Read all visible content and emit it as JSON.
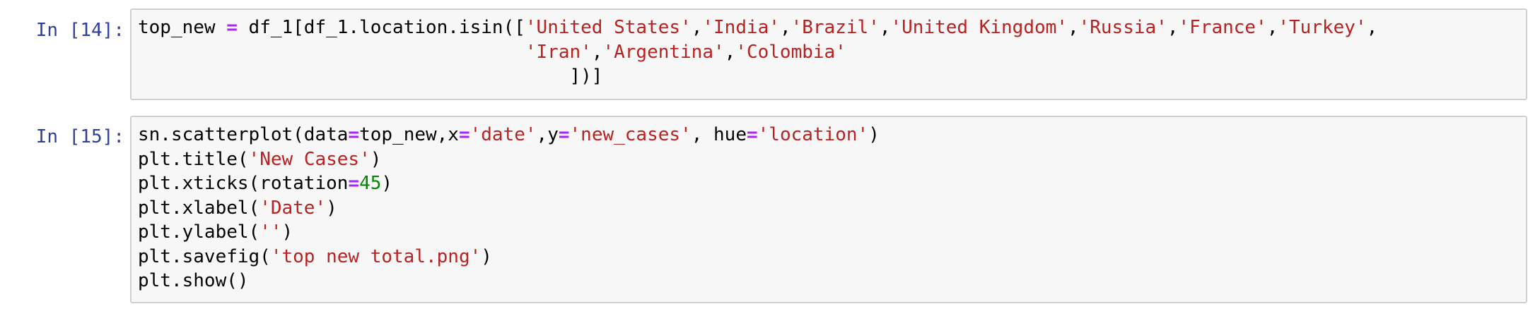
{
  "cells": [
    {
      "prompt": "In [14]:",
      "lines": [
        [
          {
            "t": "plain",
            "v": "top_new "
          },
          {
            "t": "op",
            "v": "="
          },
          {
            "t": "plain",
            "v": " df_1[df_1.location.isin(["
          },
          {
            "t": "str",
            "v": "'United States'"
          },
          {
            "t": "plain",
            "v": ","
          },
          {
            "t": "str",
            "v": "'India'"
          },
          {
            "t": "plain",
            "v": ","
          },
          {
            "t": "str",
            "v": "'Brazil'"
          },
          {
            "t": "plain",
            "v": ","
          },
          {
            "t": "str",
            "v": "'United Kingdom'"
          },
          {
            "t": "plain",
            "v": ","
          },
          {
            "t": "str",
            "v": "'Russia'"
          },
          {
            "t": "plain",
            "v": ","
          },
          {
            "t": "str",
            "v": "'France'"
          },
          {
            "t": "plain",
            "v": ","
          },
          {
            "t": "str",
            "v": "'Turkey'"
          },
          {
            "t": "plain",
            "v": ","
          }
        ],
        [
          {
            "t": "plain",
            "v": "                                   "
          },
          {
            "t": "str",
            "v": "'Iran'"
          },
          {
            "t": "plain",
            "v": ","
          },
          {
            "t": "str",
            "v": "'Argentina'"
          },
          {
            "t": "plain",
            "v": ","
          },
          {
            "t": "str",
            "v": "'Colombia'"
          }
        ],
        [
          {
            "t": "plain",
            "v": "                                       ])]"
          }
        ]
      ]
    },
    {
      "prompt": "In [15]:",
      "lines": [
        [
          {
            "t": "plain",
            "v": "sn.scatterplot(data"
          },
          {
            "t": "op",
            "v": "="
          },
          {
            "t": "plain",
            "v": "top_new,x"
          },
          {
            "t": "op",
            "v": "="
          },
          {
            "t": "str",
            "v": "'date'"
          },
          {
            "t": "plain",
            "v": ",y"
          },
          {
            "t": "op",
            "v": "="
          },
          {
            "t": "str",
            "v": "'new_cases'"
          },
          {
            "t": "plain",
            "v": ", hue"
          },
          {
            "t": "op",
            "v": "="
          },
          {
            "t": "str",
            "v": "'location'"
          },
          {
            "t": "plain",
            "v": ")"
          }
        ],
        [
          {
            "t": "plain",
            "v": "plt.title("
          },
          {
            "t": "str",
            "v": "'New Cases'"
          },
          {
            "t": "plain",
            "v": ")"
          }
        ],
        [
          {
            "t": "plain",
            "v": "plt.xticks(rotation"
          },
          {
            "t": "op",
            "v": "="
          },
          {
            "t": "num",
            "v": "45"
          },
          {
            "t": "plain",
            "v": ")"
          }
        ],
        [
          {
            "t": "plain",
            "v": "plt.xlabel("
          },
          {
            "t": "str",
            "v": "'Date'"
          },
          {
            "t": "plain",
            "v": ")"
          }
        ],
        [
          {
            "t": "plain",
            "v": "plt.ylabel("
          },
          {
            "t": "str",
            "v": "''"
          },
          {
            "t": "plain",
            "v": ")"
          }
        ],
        [
          {
            "t": "plain",
            "v": "plt.savefig("
          },
          {
            "t": "str",
            "v": "'top new total.png'"
          },
          {
            "t": "plain",
            "v": ")"
          }
        ],
        [
          {
            "t": "plain",
            "v": "plt.show()"
          }
        ]
      ]
    }
  ],
  "colors": {
    "prompt": "#303f9f",
    "string": "#ba2121",
    "operator": "#aa22ff",
    "number": "#008800",
    "cell_background": "#f7f7f7",
    "cell_border": "#cfcfcf"
  }
}
